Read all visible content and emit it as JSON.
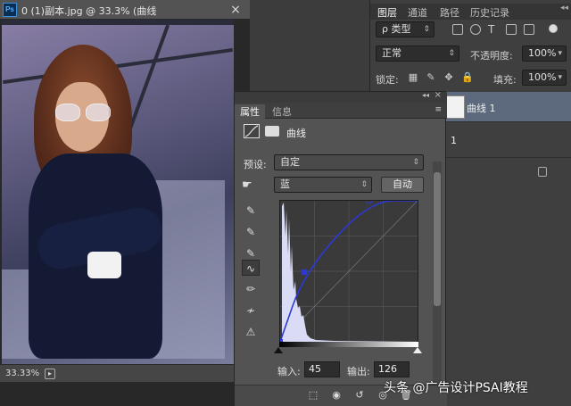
{
  "document": {
    "app_icon": "Ps",
    "title": "0 (1)副本.jpg @ 33.3% (曲线",
    "close": "×",
    "zoom": "33.33%"
  },
  "layers_panel": {
    "tabs": [
      "图层",
      "通道",
      "路径",
      "历史记录"
    ],
    "collapse": "◂◂",
    "filter_label": "ρ 类型",
    "blend_mode": "正常",
    "opacity_label": "不透明度:",
    "opacity_value": "100%",
    "lock_label": "锁定:",
    "fill_label": "填充:",
    "fill_value": "100%",
    "layers": [
      {
        "name": "曲线 1"
      },
      {
        "name": "1"
      }
    ]
  },
  "properties_panel": {
    "tabs": [
      "属性",
      "信息"
    ],
    "menu": "≡",
    "collapse": "◂◂",
    "close": "×",
    "adjustment_title": "曲线",
    "preset_label": "预设:",
    "preset_value": "自定",
    "channel_value": "蓝",
    "auto_button": "自动",
    "input_label": "输入:",
    "input_value": "45",
    "output_label": "输出:",
    "output_value": "126"
  },
  "curve": {
    "channel": "blue",
    "points": [
      [
        0,
        0
      ],
      [
        45,
        126
      ],
      [
        165,
        255
      ],
      [
        255,
        255
      ]
    ],
    "color": "#2b39d4"
  },
  "watermark": "头条 @广告设计PSAI教程"
}
